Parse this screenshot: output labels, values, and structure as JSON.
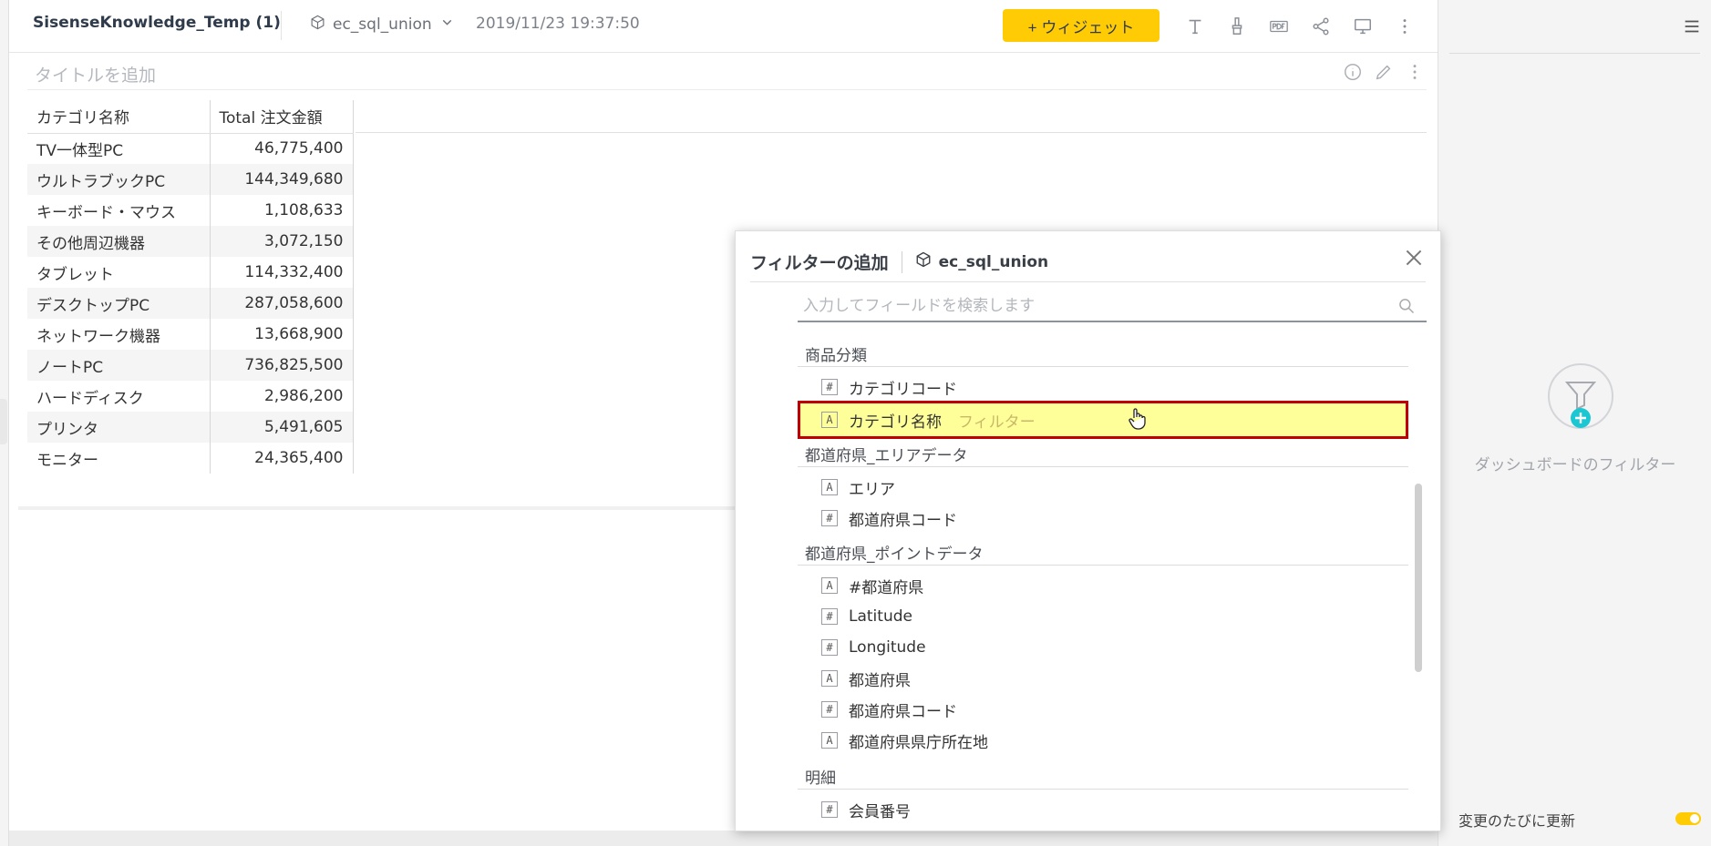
{
  "header": {
    "app_title": "SisenseKnowledge_Temp (1)",
    "datasource": "ec_sql_union",
    "timestamp": "2019/11/23 19:37:50",
    "widget_button": "+ ウィジェット",
    "toolbar_icons": [
      "text-icon",
      "brush-icon",
      "pdf-icon",
      "share-icon",
      "monitor-icon",
      "more-vertical-icon"
    ]
  },
  "widget": {
    "title_placeholder": "タイトルを追加",
    "columns": [
      "カテゴリ名称",
      "Total 注文金額"
    ],
    "rows": [
      [
        "TV一体型PC",
        "46,775,400"
      ],
      [
        "ウルトラブックPC",
        "144,349,680"
      ],
      [
        "キーボード・マウス",
        "1,108,633"
      ],
      [
        "その他周辺機器",
        "3,072,150"
      ],
      [
        "タブレット",
        "114,332,400"
      ],
      [
        "デスクトップPC",
        "287,058,600"
      ],
      [
        "ネットワーク機器",
        "13,668,900"
      ],
      [
        "ノートPC",
        "736,825,500"
      ],
      [
        "ハードディスク",
        "2,986,200"
      ],
      [
        "プリンタ",
        "5,491,605"
      ],
      [
        "モニター",
        "24,365,400"
      ]
    ]
  },
  "dialog": {
    "title": "フィルターの追加",
    "datasource": "ec_sql_union",
    "search_placeholder": "入力してフィールドを検索します",
    "groups": [
      {
        "label": "商品分類"
      },
      {
        "label": "都道府県_エリアデータ"
      },
      {
        "label": "都道府県_ポイントデータ"
      },
      {
        "label": "明細"
      }
    ],
    "fields": [
      {
        "type": "#",
        "label": "カテゴリコード"
      },
      {
        "type": "A",
        "label": "カテゴリ名称",
        "tag": "フィルター"
      },
      {
        "type": "A",
        "label": "エリア"
      },
      {
        "type": "#",
        "label": "都道府県コード"
      },
      {
        "type": "A",
        "label": "#都道府県"
      },
      {
        "type": "#",
        "label": "Latitude"
      },
      {
        "type": "#",
        "label": "Longitude"
      },
      {
        "type": "A",
        "label": "都道府県"
      },
      {
        "type": "#",
        "label": "都道府県コード"
      },
      {
        "type": "A",
        "label": "都道府県県庁所在地"
      },
      {
        "type": "#",
        "label": "会員番号"
      }
    ]
  },
  "right_panel": {
    "empty_text": "ダッシュボードのフィルター",
    "auto_update_label": "変更のたびに更新",
    "auto_update_on": true,
    "accent_color": "#ffcb05"
  }
}
